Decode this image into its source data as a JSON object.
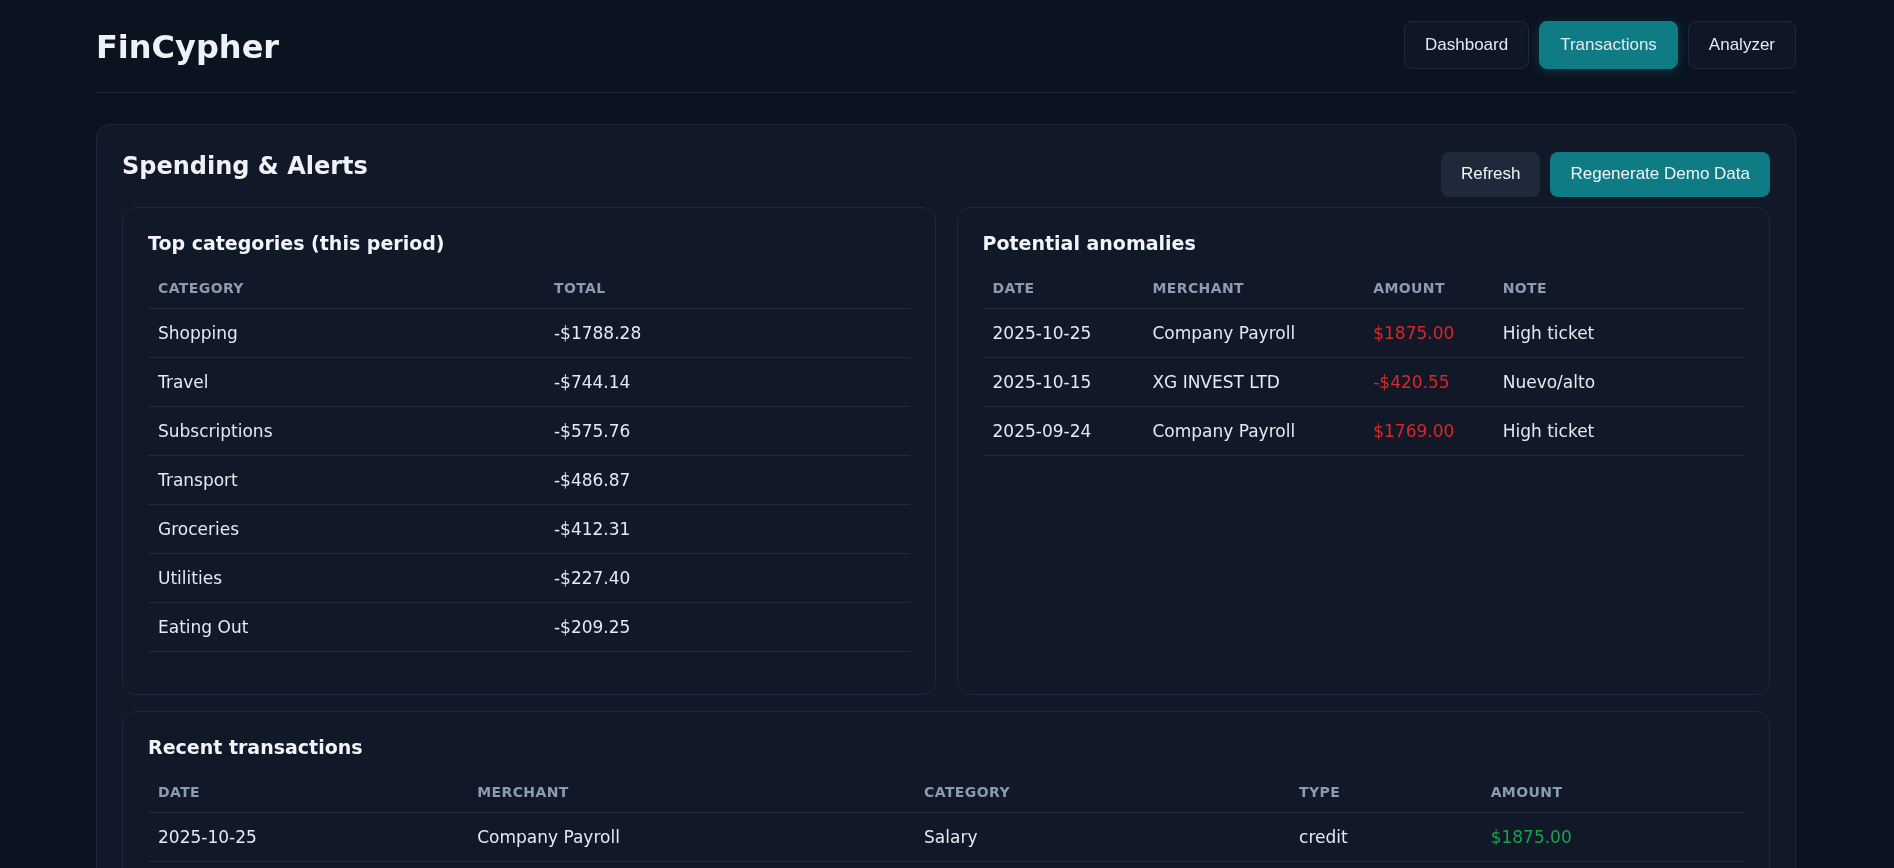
{
  "brand": "FinCypher",
  "nav": [
    {
      "label": "Dashboard",
      "selected": false
    },
    {
      "label": "Transactions",
      "selected": true
    },
    {
      "label": "Analyzer",
      "selected": false
    }
  ],
  "section": {
    "title": "Spending & Alerts",
    "actions": [
      {
        "label": "Refresh",
        "kind": "secondary"
      },
      {
        "label": "Regenerate Demo Data",
        "kind": "primary"
      }
    ]
  },
  "categories": {
    "title": "Top categories (this period)",
    "columns": [
      "CATEGORY",
      "TOTAL"
    ],
    "rows": [
      {
        "category": "Shopping",
        "total": "-$1788.28"
      },
      {
        "category": "Travel",
        "total": "-$744.14"
      },
      {
        "category": "Subscriptions",
        "total": "-$575.76"
      },
      {
        "category": "Transport",
        "total": "-$486.87"
      },
      {
        "category": "Groceries",
        "total": "-$412.31"
      },
      {
        "category": "Utilities",
        "total": "-$227.40"
      },
      {
        "category": "Eating Out",
        "total": "-$209.25"
      }
    ]
  },
  "anomalies": {
    "title": "Potential anomalies",
    "columns": [
      "DATE",
      "MERCHANT",
      "AMOUNT",
      "NOTE"
    ],
    "rows": [
      {
        "date": "2025-10-25",
        "merchant": "Company Payroll",
        "amount": "$1875.00",
        "note": "High ticket"
      },
      {
        "date": "2025-10-15",
        "merchant": "XG INVEST LTD",
        "amount": "-$420.55",
        "note": "Nuevo/alto"
      },
      {
        "date": "2025-09-24",
        "merchant": "Company Payroll",
        "amount": "$1769.00",
        "note": "High ticket"
      }
    ]
  },
  "recent": {
    "title": "Recent transactions",
    "columns": [
      "DATE",
      "MERCHANT",
      "CATEGORY",
      "TYPE",
      "AMOUNT"
    ],
    "rows": [
      {
        "date": "2025-10-25",
        "merchant": "Company Payroll",
        "category": "Salary",
        "type": "credit",
        "amount": "$1875.00"
      }
    ]
  }
}
